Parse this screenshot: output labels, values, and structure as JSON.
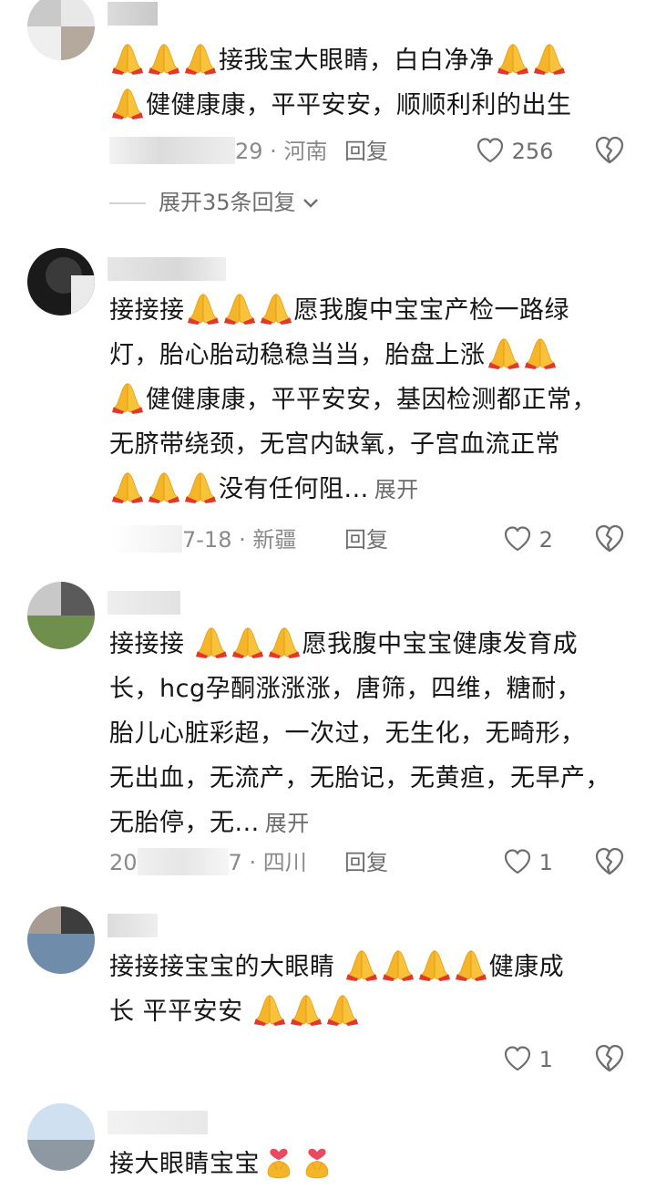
{
  "comments": [
    {
      "segments_line1": [
        "接我宝大眼睛，白白净净"
      ],
      "line1_full": "🙏🙏🙏接我宝大眼睛，白白净净🙏🙏",
      "line2_text": "健健康康，平平安安，顺顺利利的出生",
      "date_suffix": "29",
      "location": "河南",
      "reply": "回复",
      "likes": "256",
      "expand_replies": "展开35条回复"
    },
    {
      "line1_prefix": "接接接",
      "line1_text": "愿我腹中宝宝产检一路绿",
      "line2": "灯，胎心胎动稳稳当当，胎盘上涨",
      "line3": "健健康康，平平安安，基因检测都正常，",
      "line4": "无脐带绕颈，无宫内缺氧，子宫血流正常",
      "line5": "没有任何阻...",
      "expand": "展开",
      "date_suffix": "7-18",
      "location": "新疆",
      "reply": "回复",
      "likes": "2"
    },
    {
      "line1_prefix": "接接接",
      "line1_text": "愿我腹中宝宝健康发育成",
      "line2": "长，hcg孕酮涨涨涨，唐筛，四维，糖耐，",
      "line3": "胎儿心脏彩超，一次过，无生化，无畸形，",
      "line4": "无出血，无流产，无胎记，无黄疸，无早产，",
      "line5": "无胎停，无...",
      "expand": "展开",
      "date_prefix": "20",
      "date_suffix": "7",
      "location": "四川",
      "reply": "回复",
      "likes": "1"
    },
    {
      "line1_text": "接接接宝宝的大眼睛",
      "line1_after": "健康成",
      "line2_text": "长 平平安安",
      "likes": "1"
    },
    {
      "line1_text": "接大眼睛宝宝"
    }
  ],
  "colors": {
    "text": "#161616",
    "meta": "#8a8a8a",
    "emoji_yellow": "#f7b92f"
  },
  "icons": [
    "pray-icon",
    "heart-outline-icon",
    "broken-heart-icon",
    "chevron-down-icon",
    "heart-hands-icon"
  ]
}
